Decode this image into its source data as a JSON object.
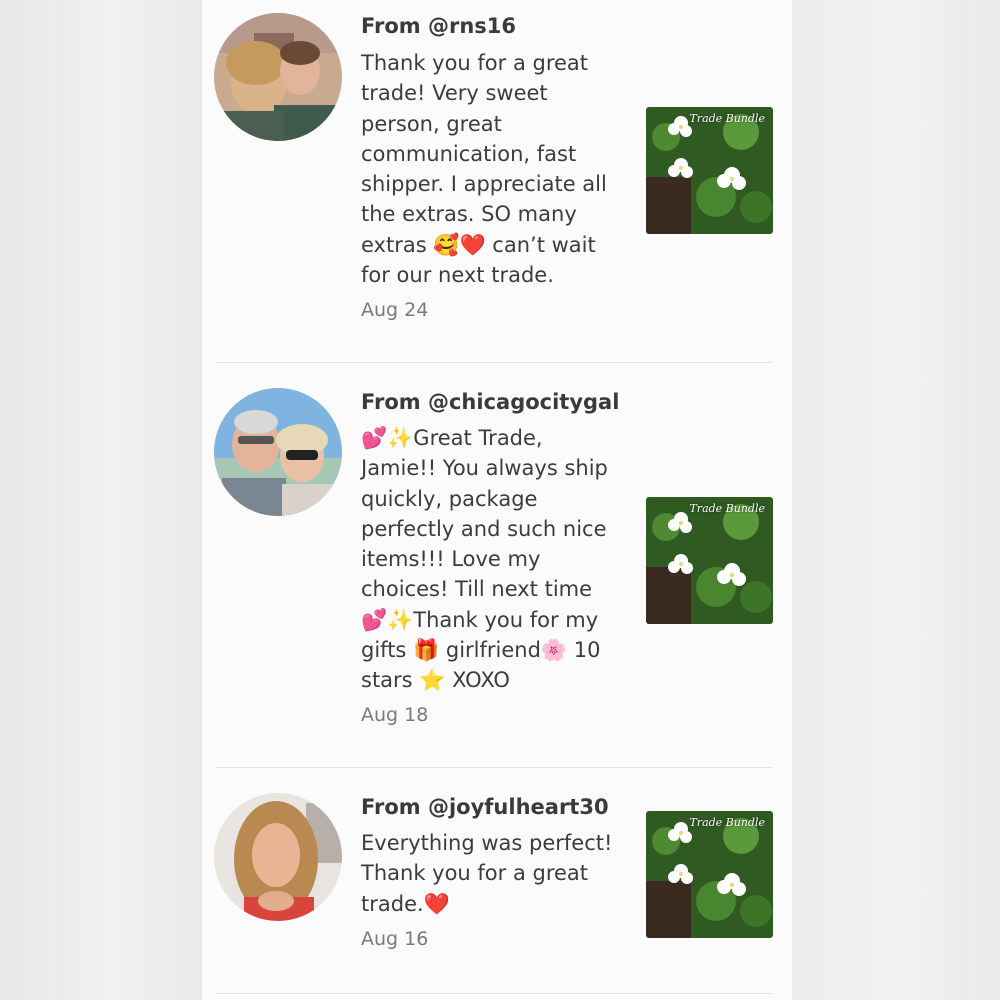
{
  "colors": {
    "panel_background": "#fcfbfc",
    "text": "#3c3c3c",
    "date_text": "#7a7a7a",
    "divider": "#e4e2e4"
  },
  "reviews": [
    {
      "from": "From @rns16",
      "message": "Thank you for a great\ntrade! Very sweet\nperson, great\ncommunication, fast\nshipper. I appreciate all\nthe extras. SO many\nextras 🥰❤️ can’t wait\nfor our next trade.",
      "date": "Aug 24",
      "thumbnail_label": "Trade Bundle",
      "thumbnail_icon": "white-flowers-photo"
    },
    {
      "from": "From @chicagocitygal",
      "message": "💕✨Great Trade,\nJamie!! You always ship\nquickly, package\nperfectly and such nice\nitems!!! Love my\nchoices! Till next time\n💕✨Thank you for my\ngifts 🎁 girlfriend🌸 10\nstars ⭐ XOXO",
      "date": "Aug 18",
      "thumbnail_label": "Trade Bundle",
      "thumbnail_icon": "white-flowers-photo"
    },
    {
      "from": "From @joyfulheart30",
      "message": "Everything was perfect!\nThank you for a great\ntrade.❤️",
      "date": "Aug 16",
      "thumbnail_label": "Trade Bundle",
      "thumbnail_icon": "white-flowers-photo"
    }
  ]
}
